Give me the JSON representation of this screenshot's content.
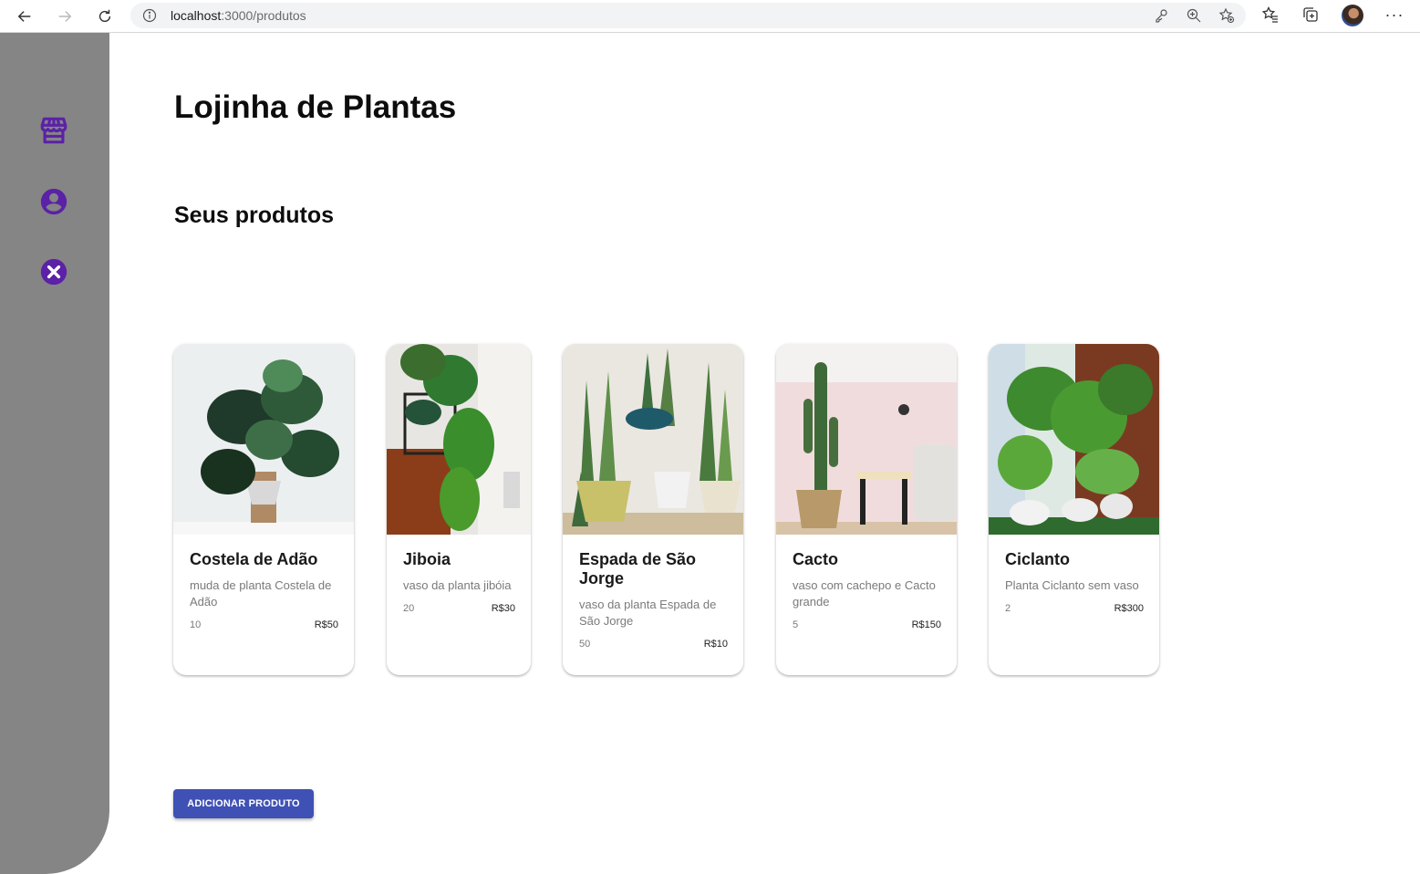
{
  "browser": {
    "url_host": "localhost",
    "url_path": ":3000/produtos",
    "icons": [
      "back-arrow-icon",
      "forward-arrow-icon",
      "reload-icon",
      "info-icon",
      "key-icon",
      "zoom-icon",
      "add-favorite-icon",
      "favorites-icon",
      "collections-icon",
      "profile-avatar",
      "more-icon"
    ]
  },
  "sidebar": {
    "icons": [
      "store-icon",
      "account-circle-icon",
      "cancel-circle-icon"
    ],
    "accent_color": "#5b21a7",
    "background_color": "#858585"
  },
  "page": {
    "title": "Lojinha de Plantas",
    "section_title": "Seus produtos"
  },
  "products": [
    {
      "name": "Costela de Adão",
      "description": "muda de planta Costela de Adão",
      "quantity": "10",
      "price": "R$50"
    },
    {
      "name": "Jiboia",
      "description": "vaso da planta jibóia",
      "quantity": "20",
      "price": "R$30"
    },
    {
      "name": "Espada de São Jorge",
      "description": "vaso da planta Espada de São Jorge",
      "quantity": "50",
      "price": "R$10"
    },
    {
      "name": "Cacto",
      "description": "vaso com cachepo e Cacto grande",
      "quantity": "5",
      "price": "R$150"
    },
    {
      "name": "Ciclanto",
      "description": "Planta Ciclanto sem vaso",
      "quantity": "2",
      "price": "R$300"
    }
  ],
  "actions": {
    "add_product_label": "ADICIONAR PRODUTO",
    "button_color": "#3f51b5"
  }
}
